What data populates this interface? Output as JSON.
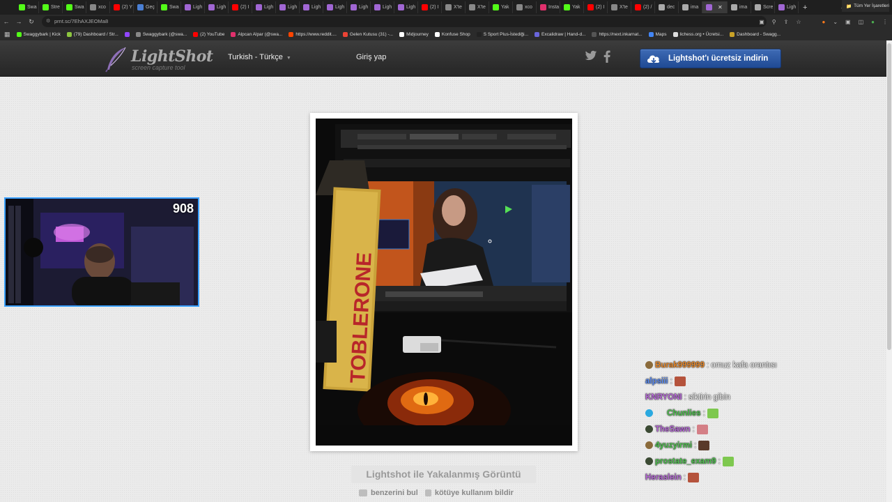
{
  "browser": {
    "tabs": [
      {
        "label": "Swa",
        "color": "#53fc18"
      },
      {
        "label": "Stre",
        "color": "#53fc18"
      },
      {
        "label": "Swa",
        "color": "#53fc18"
      },
      {
        "label": "xco",
        "color": "#888888"
      },
      {
        "label": "(2) Y",
        "color": "#ff0000"
      },
      {
        "label": "Geç",
        "color": "#4a7fd4"
      },
      {
        "label": "Swa",
        "color": "#53fc18"
      },
      {
        "label": "Ligh",
        "color": "#a066d3"
      },
      {
        "label": "Ligh",
        "color": "#a066d3"
      },
      {
        "label": "(2) I",
        "color": "#ff0000"
      },
      {
        "label": "Ligh",
        "color": "#a066d3"
      },
      {
        "label": "Ligh",
        "color": "#a066d3"
      },
      {
        "label": "Ligh",
        "color": "#a066d3"
      },
      {
        "label": "Ligh",
        "color": "#a066d3"
      },
      {
        "label": "Ligh",
        "color": "#a066d3"
      },
      {
        "label": "Ligh",
        "color": "#a066d3"
      },
      {
        "label": "Ligh",
        "color": "#a066d3"
      },
      {
        "label": "(2) I",
        "color": "#ff0000"
      },
      {
        "label": "X'te",
        "color": "#888888"
      },
      {
        "label": "X'te",
        "color": "#888888"
      },
      {
        "label": "Yak",
        "color": "#53fc18"
      },
      {
        "label": "xco",
        "color": "#888888"
      },
      {
        "label": "Insta",
        "color": "#e1306c"
      },
      {
        "label": "Yak",
        "color": "#53fc18"
      },
      {
        "label": "(2) I",
        "color": "#ff0000"
      },
      {
        "label": "X'te",
        "color": "#888888"
      },
      {
        "label": "(2) /",
        "color": "#ff0000"
      },
      {
        "label": "dec",
        "color": "#aaaaaa"
      },
      {
        "label": "ima",
        "color": "#aaaaaa"
      },
      {
        "label": "",
        "color": "#a066d3",
        "active": true
      },
      {
        "label": "ima",
        "color": "#aaaaaa"
      },
      {
        "label": "Scre",
        "color": "#aaaaaa"
      },
      {
        "label": "Ligh",
        "color": "#a066d3"
      }
    ],
    "url": "prnt.sc/7EhAXJEOMa8",
    "bookmarks": [
      {
        "label": "Swaggybark | Kick",
        "color": "#53fc18"
      },
      {
        "label": "(79) Dashboard / Str...",
        "color": "#8dc63f"
      },
      {
        "label": "",
        "color": "#9146ff"
      },
      {
        "label": "Swaggybark (@swa...",
        "color": "#888888"
      },
      {
        "label": "(2) YouTube",
        "color": "#ff0000"
      },
      {
        "label": "Alpcan Alpar (@swa...",
        "color": "#e1306c"
      },
      {
        "label": "https://www.reddit....",
        "color": "#ff4500"
      },
      {
        "label": "Gelen Kutusu (31) -...",
        "color": "#ea4335"
      },
      {
        "label": "Midjourney",
        "color": "#ffffff"
      },
      {
        "label": "Konfuse Shop",
        "color": "#ffffff"
      },
      {
        "label": "S Sport Plus-İstediği...",
        "color": "#222222"
      },
      {
        "label": "Excalidraw | Hand-d...",
        "color": "#6965db"
      },
      {
        "label": "https://next.inkarnat...",
        "color": "#555555"
      },
      {
        "label": "Maps",
        "color": "#4285f4"
      },
      {
        "label": "lichess.org • Ücretsi...",
        "color": "#dddddd"
      },
      {
        "label": "Dashboard - Swagg...",
        "color": "#c9a227"
      }
    ],
    "all_bookmarks": "Tüm Yer İşaretleri"
  },
  "site": {
    "logo_name": "LightShot",
    "logo_tagline": "screen capture tool",
    "language": "Turkish - Türkçe",
    "login": "Giriş yap",
    "download": "Lightshot'ı ücretsiz indirin"
  },
  "screenshot": {
    "caption": "Lightshot ile Yakalanmış Görüntü",
    "find_similar": "benzerini bul",
    "report_abuse": "kötüye kullanım bildir",
    "photo": {
      "bar_label": "TOBLERONE",
      "inner_viewers": "908"
    }
  },
  "stream": {
    "viewer_count": "908",
    "chat": [
      {
        "user": "Burak999999",
        "color": "#e8892b",
        "text": "omuz kafa orantısı",
        "badge": "#8a6a3a",
        "emote": ""
      },
      {
        "user": "alpsiii",
        "color": "#5b8df5",
        "text": "",
        "badge": "",
        "emote": "#b5533c"
      },
      {
        "user": "KNRYONI",
        "color": "#b86ad9",
        "text": "siktirin gibin",
        "badge": "",
        "emote": ""
      },
      {
        "user": "Chunlies",
        "color": "#4ec24e",
        "text": "",
        "badge": "#2aa9e0",
        "emote": "#7ec84f"
      },
      {
        "user": "TheSawn",
        "color": "#b86ad9",
        "text": "",
        "badge": "#3b4a33",
        "emote": "#d47f86"
      },
      {
        "user": "4yuzyirmi",
        "color": "#4ec24e",
        "text": "",
        "badge": "#8a6a3a",
        "emote": "#5a3a2a"
      },
      {
        "user": "prostate_exam9",
        "color": "#4ec24e",
        "text": "",
        "badge": "#3b4a33",
        "emote": "#7ec84f"
      },
      {
        "user": "Heraslein",
        "color": "#b86ad9",
        "text": "",
        "badge": "",
        "emote": "#b5533c"
      }
    ]
  },
  "colors": {
    "header_bg": "#2f2f2f",
    "download_button": "#2b57a5",
    "webcam_border": "#3aa0ff"
  },
  "icons": [
    "reload-icon",
    "back-icon",
    "forward-icon",
    "star-icon",
    "twitter-icon",
    "facebook-icon",
    "download-cloud-icon",
    "camera-icon",
    "flag-icon"
  ]
}
